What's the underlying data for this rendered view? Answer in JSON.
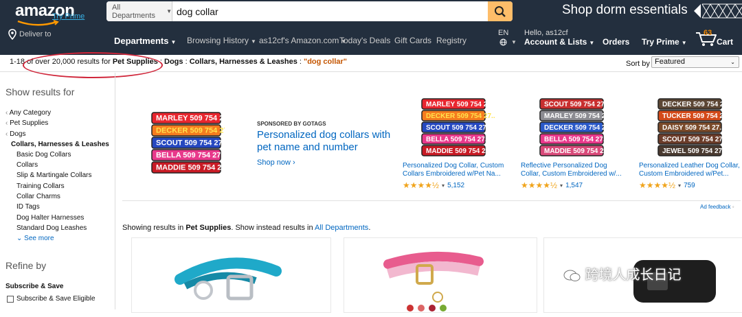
{
  "header": {
    "logo_text": "amazon",
    "logo_sub": "Try Prime",
    "search": {
      "department": "All Departments",
      "query": "dog collar"
    },
    "promo": "Shop dorm essentials",
    "deliver_to": "Deliver to",
    "departments": "Departments",
    "nav": [
      "Browsing History",
      "as12cf's Amazon.com",
      "Today's Deals",
      "Gift Cards",
      "Registry"
    ],
    "lang": "EN",
    "hello": "Hello, as12cf",
    "account": "Account & Lists",
    "orders": "Orders",
    "prime": "Try Prime",
    "cart_count": "63",
    "cart": "Cart"
  },
  "results_bar": {
    "count": "1-18 of over 20,000 results for ",
    "cat1": "Pet Supplies",
    "sep": " : ",
    "cat2": "Dogs",
    "cat3": "Collars, Harnesses & Leashes",
    "query": "\"dog collar\"",
    "sort_label": "Sort by",
    "sort_value": "Featured"
  },
  "sidebar": {
    "heading": "Show results for",
    "any_category": "Any Category",
    "pet_supplies": "Pet Supplies",
    "dogs": "Dogs",
    "current": "Collars, Harnesses & Leashes",
    "subcategories": [
      "Basic Dog Collars",
      "Collars",
      "Slip & Martingale Collars",
      "Training Collars",
      "Collar Charms",
      "ID Tags",
      "Dog Halter Harnesses",
      "Standard Dog Leashes"
    ],
    "see_more": "See more",
    "refine": "Refine by",
    "subscribe_heading": "Subscribe & Save",
    "subscribe_option": "Subscribe & Save Eligible"
  },
  "sponsored": {
    "label": "SPONSORED BY GOTAGS",
    "title": "Personalized dog collars with pet name and number",
    "shop_now": "Shop now ›",
    "collar_names": [
      "MARLEY 509 754 27..",
      "DECKER 509 754 27..",
      "SCOUT 509 754 27..",
      "BELLA 509 754 27..",
      "MADDIE 509 754 27.."
    ],
    "collar_colors": [
      "#e8262f",
      "#f57c1f",
      "#2548c0",
      "#e8398b",
      "#c81b25"
    ]
  },
  "products": [
    {
      "title": "Personalized Dog Collar, Custom Collars Embroidered w/Pet Na...",
      "stars": "★★★★½",
      "reviews": "5,152"
    },
    {
      "title": "Reflective Personalized Dog Collar, Custom Embroidered w/...",
      "stars": "★★★★½",
      "reviews": "1,547"
    },
    {
      "title": "Personalized Leather Dog Collar, Custom Embroidered w/Pet...",
      "stars": "★★★★½",
      "reviews": "759"
    }
  ],
  "product_tags": [
    [
      "MARLEY 509 754 27..",
      "DECKER 509 754 27..",
      "SCOUT 509 754 27..",
      "BELLA 509 754 27..",
      "MADDIE 509 754 27.."
    ],
    [
      "SCOUT 509 754 27..",
      "MARLEY 509 754 27..",
      "DECKER 509 754 27..",
      "BELLA 509 754 27..",
      "MADDIE 509 754 27.."
    ],
    [
      "DECKER 509 754 27..",
      "TUCKER 509 754 27..",
      "DAISY 509 754 27..",
      "SCOUT 509 754 27..",
      "JEWEL 509 754 27.."
    ]
  ],
  "ad_feedback": "Ad feedback",
  "showing": {
    "prefix": "Showing results in ",
    "category": "Pet Supplies",
    "middle": ". Show instead results in ",
    "all": "All Departments",
    "suffix": "."
  },
  "watermark": "跨境人成长日记",
  "colors": {
    "nav_bg": "#232f3e",
    "search_btn": "#febd69",
    "link": "#0066c0",
    "star": "#f0a41c",
    "highlight_oval": "#d0263a"
  }
}
